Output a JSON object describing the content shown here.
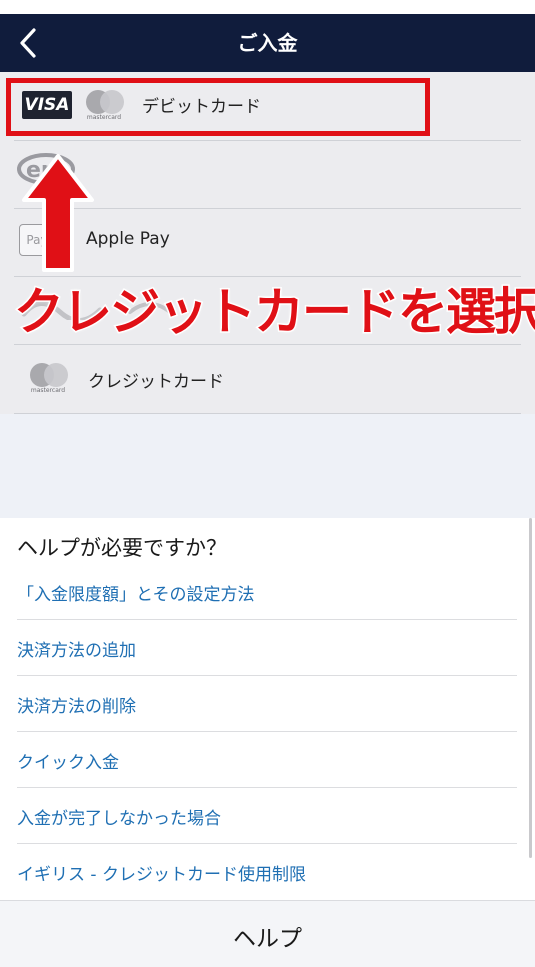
{
  "header": {
    "title": "ご入金"
  },
  "methods": [
    {
      "label": "デビットカード",
      "icons": [
        "visa-logo",
        "mastercard-logo"
      ],
      "logo_text": "VISA",
      "mc_text": "mastercard"
    },
    {
      "label": "",
      "icons": [
        "eps-logo"
      ],
      "logo_text": "ep"
    },
    {
      "label": "Apple Pay",
      "icons": [
        "apple-pay-logo"
      ],
      "logo_text": "Pay"
    },
    {
      "label": "",
      "icons": [
        "faded-logo"
      ]
    },
    {
      "label": "クレジットカード",
      "icons": [
        "mastercard-logo"
      ],
      "mc_text": "mastercard"
    }
  ],
  "annotation": {
    "text": "クレジットカードを選択",
    "color": "#e01016"
  },
  "help": {
    "title": "ヘルプが必要ですか？",
    "links": [
      "「入金限度額」とその設定方法",
      "決済方法の追加",
      "決済方法の削除",
      "クイック入金",
      "入金が完了しなかった場合",
      "イギリス - クレジットカード使用制限"
    ],
    "link_color": "#1f6fb3"
  },
  "footer": {
    "label": "ヘルプ"
  },
  "colors": {
    "header_bg": "#101c3c",
    "methods_bg": "#ececef",
    "page_bg": "#eef1f7"
  }
}
